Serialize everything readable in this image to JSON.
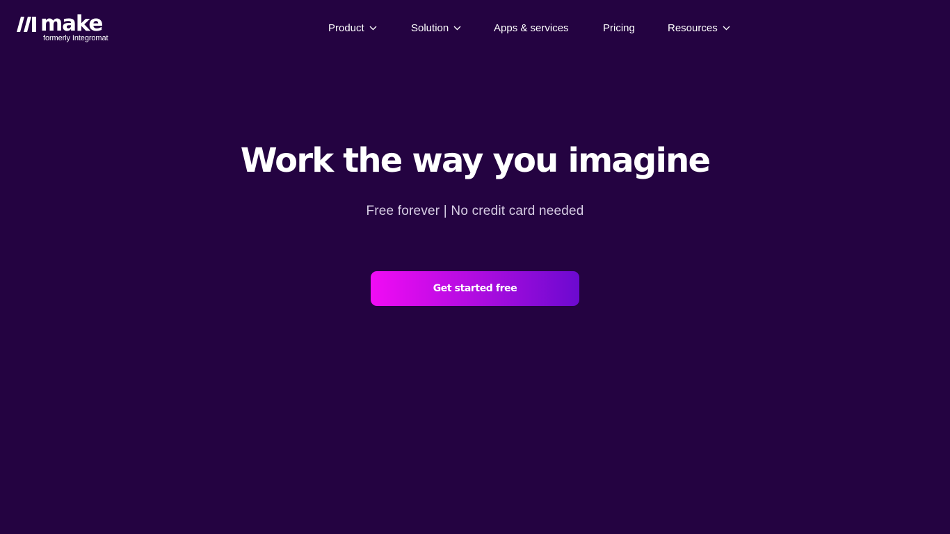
{
  "brand": {
    "logo_word": "make",
    "logo_subtitle": "formerly Integromat",
    "logo_icon": "make-logo-icon"
  },
  "nav": {
    "items": [
      {
        "label": "Product",
        "has_dropdown": true,
        "icon": "chevron-down-icon"
      },
      {
        "label": "Solution",
        "has_dropdown": true,
        "icon": "chevron-down-icon"
      },
      {
        "label": "Apps & services",
        "has_dropdown": false
      },
      {
        "label": "Pricing",
        "has_dropdown": false
      },
      {
        "label": "Resources",
        "has_dropdown": true,
        "icon": "chevron-down-icon"
      }
    ]
  },
  "hero": {
    "title": "Work the way you imagine",
    "subtitle": "Free forever | No credit card needed",
    "cta_label": "Get started free"
  },
  "colors": {
    "background": "#240341",
    "text": "#ffffff",
    "subtitle_text": "#d9cfe6",
    "cta_gradient_start": "#f10cf4",
    "cta_gradient_end": "#6c0ad0"
  }
}
